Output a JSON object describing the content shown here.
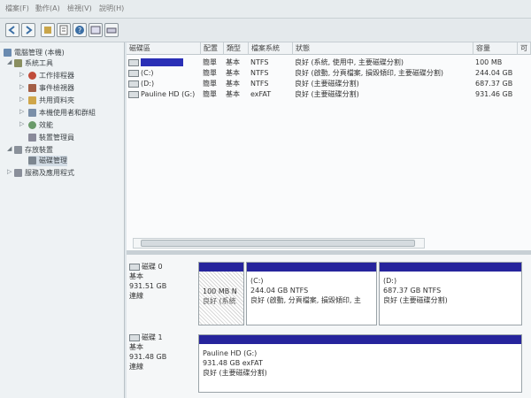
{
  "menu": [
    "檔案(F)",
    "動作(A)",
    "檢視(V)",
    "說明(H)"
  ],
  "tree": {
    "root": "電腦管理 (本機)",
    "items": [
      {
        "label": "系統工具",
        "level": 1
      },
      {
        "label": "工作排程器",
        "level": 2
      },
      {
        "label": "事件檢視器",
        "level": 2
      },
      {
        "label": "共用資料夾",
        "level": 2
      },
      {
        "label": "本機使用者和群組",
        "level": 2
      },
      {
        "label": "效能",
        "level": 2
      },
      {
        "label": "裝置管理員",
        "level": 2
      },
      {
        "label": "存放裝置",
        "level": 1
      },
      {
        "label": "磁碟管理",
        "level": 2
      },
      {
        "label": "服務及應用程式",
        "level": 1
      }
    ]
  },
  "volume_list": {
    "headers": [
      "磁碟區",
      "配置",
      "類型",
      "檔案系統",
      "狀態",
      "容量",
      "可"
    ],
    "rows": [
      {
        "name": "",
        "redacted": true,
        "layout": "簡單",
        "type": "基本",
        "fs": "NTFS",
        "status": "良好 (系統, 使用中, 主要磁碟分割)",
        "capacity": "100 MB"
      },
      {
        "name": "(C:)",
        "redacted": false,
        "layout": "簡單",
        "type": "基本",
        "fs": "NTFS",
        "status": "良好 (啟動, 分頁檔案, 損毀傾印, 主要磁碟分割)",
        "capacity": "244.04 GB"
      },
      {
        "name": "(D:)",
        "redacted": false,
        "layout": "簡單",
        "type": "基本",
        "fs": "NTFS",
        "status": "良好 (主要磁碟分割)",
        "capacity": "687.37 GB"
      },
      {
        "name": "Pauline HD (G:)",
        "redacted": false,
        "layout": "簡單",
        "type": "基本",
        "fs": "exFAT",
        "status": "良好 (主要磁碟分割)",
        "capacity": "931.46 GB"
      }
    ]
  },
  "disks": [
    {
      "name": "磁碟 0",
      "type": "基本",
      "size": "931.51 GB",
      "state": "連線",
      "partitions": [
        {
          "title": "",
          "size": "100 MB N",
          "status": "良好 (系統",
          "hatched": true
        },
        {
          "title": "(C:)",
          "size": "244.04 GB NTFS",
          "status": "良好 (啟動, 分頁檔案, 損毀傾印, 主",
          "hatched": false
        },
        {
          "title": "(D:)",
          "size": "687.37 GB NTFS",
          "status": "良好 (主要磁碟分割)",
          "hatched": false
        }
      ]
    },
    {
      "name": "磁碟 1",
      "type": "基本",
      "size": "931.48 GB",
      "state": "連線",
      "partitions": [
        {
          "title": "Pauline HD (G:)",
          "size": "931.48 GB exFAT",
          "status": "良好 (主要磁碟分割)",
          "hatched": false
        }
      ]
    }
  ],
  "colors": {
    "partition_bar": "#26249c",
    "redaction": "#2a2fb6"
  },
  "icons": [
    "back-icon",
    "forward-icon",
    "up-icon",
    "properties-icon",
    "help-icon",
    "view-icon",
    "computer-icon",
    "tools-icon",
    "disk-icon"
  ]
}
